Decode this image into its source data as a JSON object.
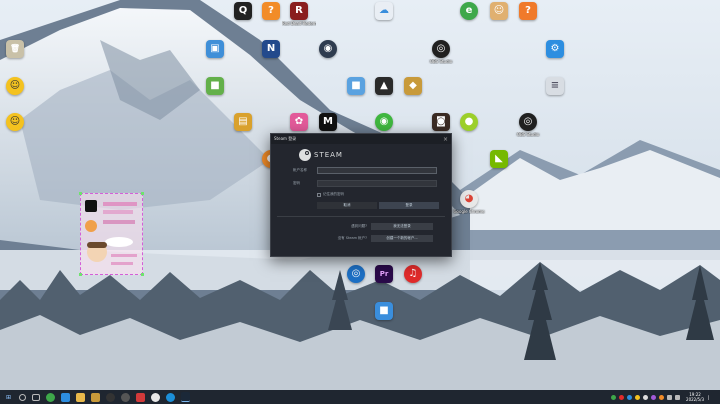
{
  "steam": {
    "title": "Steam 登录",
    "close_glyph": "×",
    "wordmark": "STEAM",
    "account_label": "帐户名称",
    "account_value": "",
    "password_label": "密码",
    "password_value": "",
    "remember_label": "记住我的密码",
    "login_label": "登录",
    "cancel_label": "取消",
    "help_lost_text": "遇到问题?",
    "help_lost_button": "我无法登录",
    "help_new_text": "没有 Steam 帐户?",
    "help_new_button": "创建一个新的帐户..."
  },
  "desktop_icons": [
    {
      "name": "qq",
      "label": "",
      "color": "#222222",
      "glyph": "Q"
    },
    {
      "name": "app-orange",
      "label": "",
      "color": "#f28c28",
      "glyph": "?"
    },
    {
      "name": "game-red",
      "label": "Red Dead Redemption 2",
      "color": "#8a1e1e",
      "glyph": "R"
    },
    {
      "name": "app-cloud",
      "label": "",
      "color": "#e9eef4",
      "glyph": "☁"
    },
    {
      "name": "app-green",
      "label": "",
      "color": "#3ea84a",
      "glyph": "e"
    },
    {
      "name": "app-avatar",
      "label": "",
      "color": "#e0b070",
      "glyph": "☺"
    },
    {
      "name": "app-orange-2",
      "label": "",
      "color": "#f07a2a",
      "glyph": "?"
    },
    {
      "name": "recycle-bin",
      "label": "",
      "color": "#c9c1a8",
      "glyph": "🗑"
    },
    {
      "name": "folder-blue",
      "label": "",
      "color": "#3f8fd8",
      "glyph": "▣"
    },
    {
      "name": "app-n",
      "label": "",
      "color": "#234a8c",
      "glyph": "N"
    },
    {
      "name": "app-globe",
      "label": "",
      "color": "#2f3c4f",
      "glyph": "◉"
    },
    {
      "name": "obs-studio",
      "label": "OBS Studio",
      "color": "#202020",
      "glyph": "◎"
    },
    {
      "name": "app-blue-settings",
      "label": "",
      "color": "#2d8ee0",
      "glyph": "⚙"
    },
    {
      "name": "app-yellow",
      "label": "",
      "color": "#f4c21f",
      "glyph": "☺"
    },
    {
      "name": "app-green-2",
      "label": "",
      "color": "#63b04a",
      "glyph": "■"
    },
    {
      "name": "app-blue-2",
      "label": "",
      "color": "#5aa2e0",
      "glyph": "■"
    },
    {
      "name": "app-dark",
      "label": "",
      "color": "#2a2a2a",
      "glyph": "▲"
    },
    {
      "name": "app-gold",
      "label": "",
      "color": "#c89a3a",
      "glyph": "◆"
    },
    {
      "name": "app-doc",
      "label": "",
      "color": "#d8dde3",
      "glyph": "≡"
    },
    {
      "name": "app-yellow-2",
      "label": "",
      "color": "#f4c21f",
      "glyph": "☺"
    },
    {
      "name": "app-bag",
      "label": "",
      "color": "#d9a12c",
      "glyph": "▤"
    },
    {
      "name": "app-colorful",
      "label": "",
      "color": "#e35a9a",
      "glyph": "✿"
    },
    {
      "name": "app-mw",
      "label": "",
      "color": "#111111",
      "glyph": "M"
    },
    {
      "name": "wechat",
      "label": "",
      "color": "#3fb73f",
      "glyph": "◉"
    },
    {
      "name": "app-game-dark",
      "label": "",
      "color": "#3a2a22",
      "glyph": "◙"
    },
    {
      "name": "app-green-round",
      "label": "",
      "color": "#9ccf2a",
      "glyph": "●"
    },
    {
      "name": "obs-studio-2",
      "label": "OBS Studio",
      "color": "#202020",
      "glyph": "◎"
    },
    {
      "name": "nvidia",
      "label": "",
      "color": "#76b900",
      "glyph": "◣"
    },
    {
      "name": "app-orange-3",
      "label": "",
      "color": "#f28c28",
      "glyph": "◐"
    },
    {
      "name": "google-chrome",
      "label": "Google Chrome",
      "color": "#e8e8e8",
      "glyph": "◕"
    },
    {
      "name": "app-sphere",
      "label": "",
      "color": "#1c6fc4",
      "glyph": "◎"
    },
    {
      "name": "adobe-premiere",
      "label": "",
      "color": "#2a0a4a",
      "glyph": "Pr"
    },
    {
      "name": "netease-music",
      "label": "",
      "color": "#e02b2b",
      "glyph": "♫"
    },
    {
      "name": "app-blue-3",
      "label": "",
      "color": "#3a8edc",
      "glyph": "■"
    }
  ],
  "taskbar": {
    "start_glyph": "⊞",
    "clock_time": "19:22",
    "clock_date": "2022/5/3",
    "show_desktop_glyph": "▏"
  }
}
